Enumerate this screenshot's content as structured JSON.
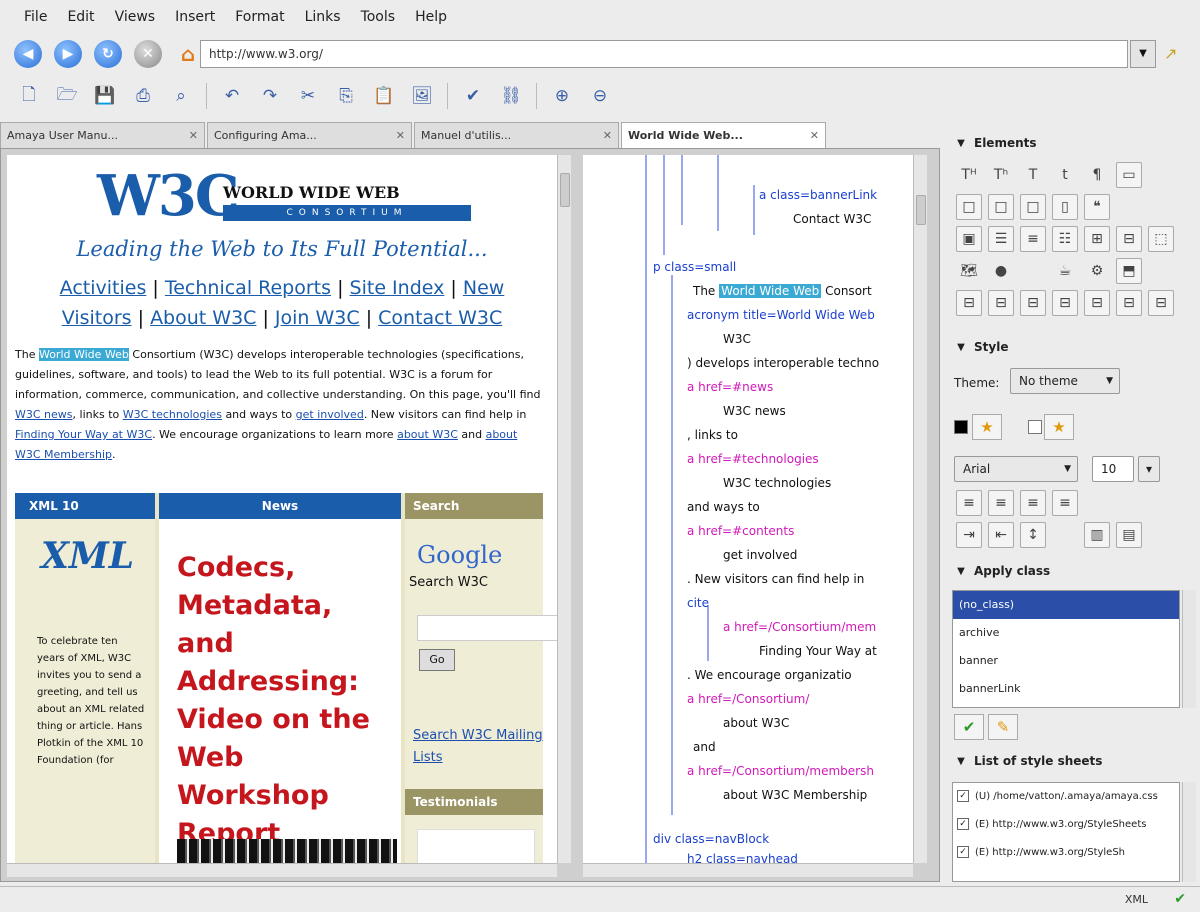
{
  "menu": [
    "File",
    "Edit",
    "Views",
    "Insert",
    "Format",
    "Links",
    "Tools",
    "Help"
  ],
  "address": {
    "url": "http://www.w3.org/"
  },
  "tabs": [
    {
      "label": "Amaya User Manu...",
      "active": false
    },
    {
      "label": "Configuring Ama...",
      "active": false
    },
    {
      "label": "Manuel d'utilis...",
      "active": false
    },
    {
      "label": "World Wide Web...",
      "active": true
    }
  ],
  "page": {
    "logo": "W3C",
    "logo_title": "WORLD WIDE WEB",
    "logo_sub": "CONSORTIUM",
    "tagline": "Leading the Web to Its Full Potential...",
    "nav": [
      "Activities",
      "Technical Reports",
      "Site Index",
      "New Visitors",
      "About W3C",
      "Join W3C",
      "Contact W3C"
    ],
    "intro": {
      "p1": "The",
      "hl": "World Wide Web",
      "p2": "Consortium (W3C) develops interoperable technologies (specifications, guidelines, software, and tools) to lead the Web to its full potential. W3C is a forum for information, commerce, communication, and collective understanding. On this page, you'll find",
      "l1": "W3C news",
      "p3": ", links to",
      "l2": "W3C technologies",
      "p4": "and ways to",
      "l3": "get involved",
      "p5": ". New visitors can find help in",
      "l4": "Finding Your Way at W3C",
      "p6": ". We encourage organizations to learn more",
      "l5": "about W3C",
      "p7": "and",
      "l6": "about W3C Membership",
      "p8": "."
    },
    "col1": {
      "head": "XML 10",
      "logo": "XML",
      "text": "To celebrate ten years of XML, W3C invites you to send a greeting, and tell us about an XML related thing or article. Hans Plotkin of the XML 10 Foundation (for"
    },
    "col2": {
      "head": "News",
      "headline": "Codecs, Metadata, and Addressing: Video on the Web Workshop Report"
    },
    "col3": {
      "head": "Search",
      "google": "Google",
      "search_label": "Search W3C",
      "go": "Go",
      "maillist": "Search W3C Mailing Lists",
      "testimonials": "Testimonials"
    }
  },
  "tree": {
    "n1": "a class=bannerLink",
    "n2": "Contact W3C",
    "n3": "p class=small",
    "n4a": "The",
    "n4b": "World Wide Web",
    "n4c": "Consort",
    "n5": "acronym title=World Wide Web",
    "n6": "W3C",
    "n7": ") develops interoperable techno",
    "n8": "a href=#news",
    "n9": "W3C news",
    "n10": ", links to",
    "n11": "a href=#technologies",
    "n12": "W3C technologies",
    "n13": "and ways to",
    "n14": "a href=#contents",
    "n15": "get involved",
    "n16": ". New visitors can find help in",
    "n17": "cite",
    "n18": "a href=/Consortium/mem",
    "n19": "Finding Your Way at",
    "n20": ". We encourage organizatio",
    "n21": "a href=/Consortium/",
    "n22": "about W3C",
    "n23": "and",
    "n24": "a href=/Consortium/membersh",
    "n25": "about W3C Membership",
    "n26": "div class=navBlock",
    "n27": "h2 class=navhead"
  },
  "side": {
    "elements_title": "Elements",
    "style_title": "Style",
    "theme_label": "Theme:",
    "theme_value": "No theme",
    "font_value": "Arial",
    "size_value": "10",
    "apply_title": "Apply class",
    "classes": [
      "(no_class)",
      "archive",
      "banner",
      "bannerLink"
    ],
    "stylesheets_title": "List of style sheets",
    "stylesheets": [
      "(U) /home/vatton/.amaya/amaya.css",
      "(E) http://www.w3.org/StyleSheets",
      "(E) http://www.w3.org/StyleSh"
    ]
  },
  "status": {
    "text": "XML"
  }
}
